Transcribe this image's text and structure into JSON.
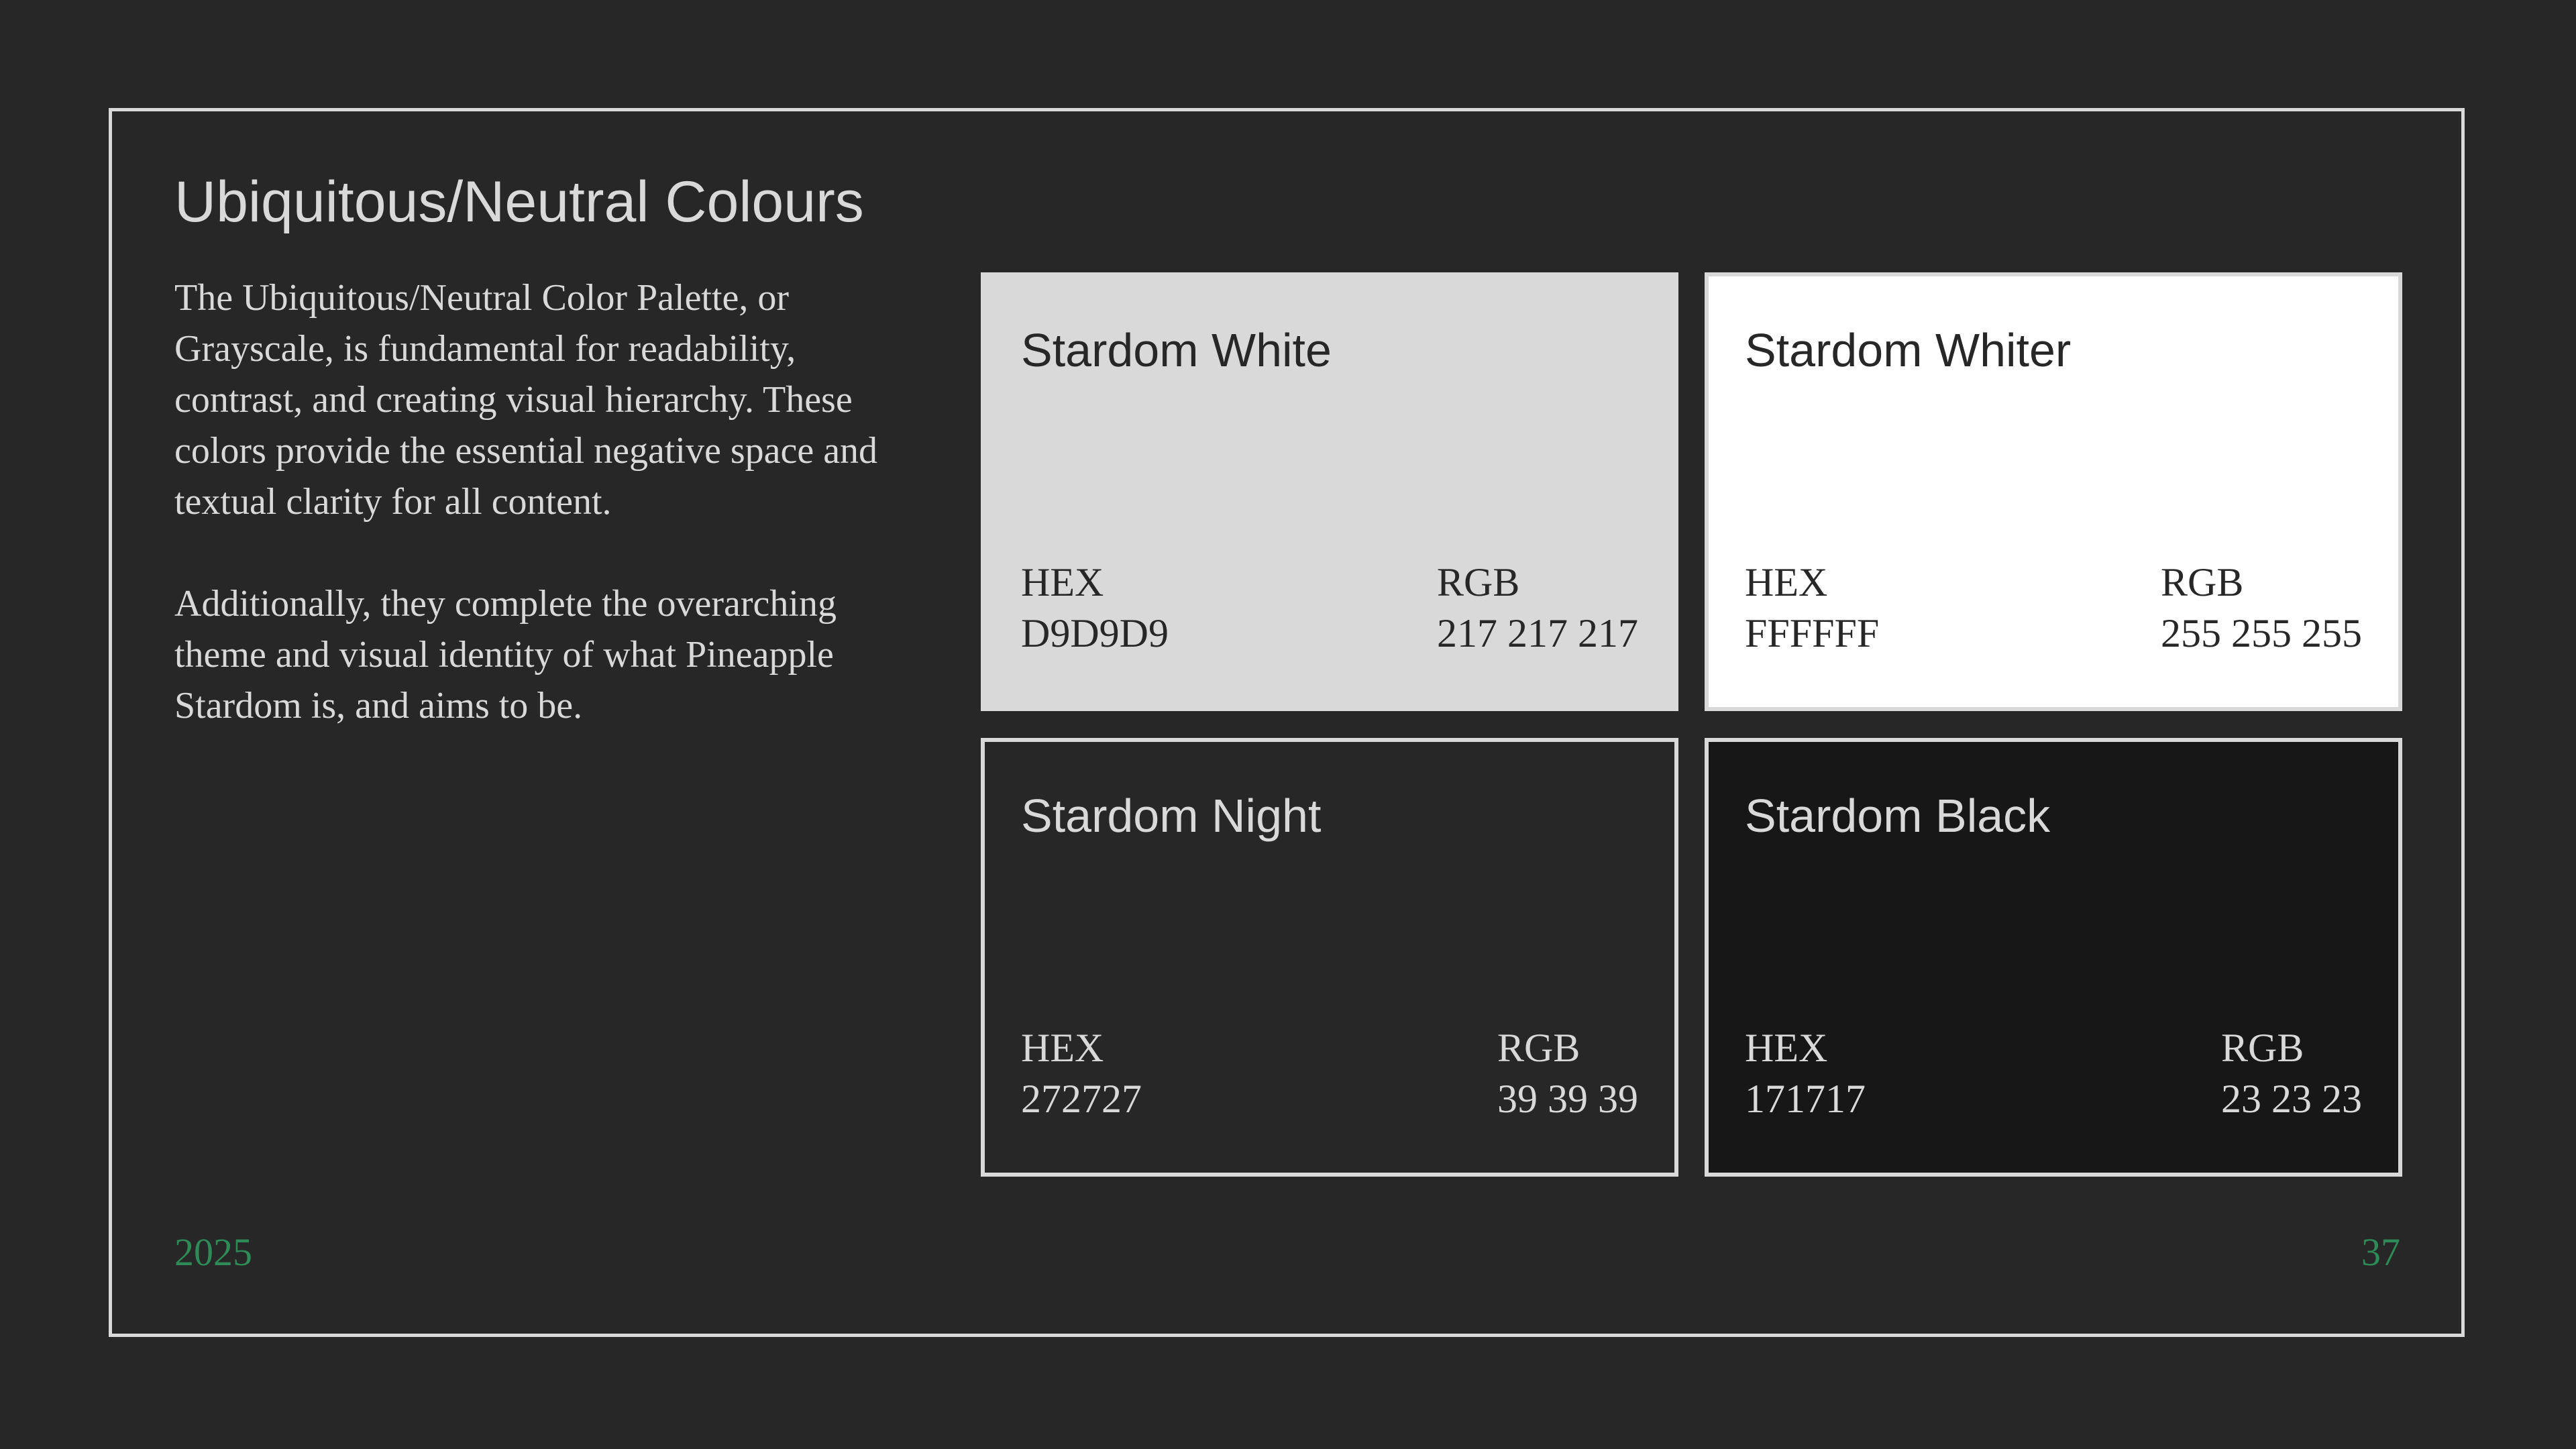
{
  "slide": {
    "title": "Ubiquitous/Neutral Colours",
    "paragraphs": [
      "The Ubiquitous/Neutral Color Palette, or Grayscale, is fundamental for readability, contrast, and creating visual hierarchy. These colors provide the essential negative space and textual clarity for all content.",
      "Additionally, they complete the overarching theme and visual identity of what Pineapple Stardom is, and aims to be."
    ],
    "year": "2025",
    "page_number": "37"
  },
  "swatches": [
    {
      "name": "Stardom White",
      "hex_label": "HEX",
      "hex_value": "D9D9D9",
      "rgb_label": "RGB",
      "rgb_value": "217 217 217",
      "color": "#D9D9D9"
    },
    {
      "name": "Stardom Whiter",
      "hex_label": "HEX",
      "hex_value": "FFFFFF",
      "rgb_label": "RGB",
      "rgb_value": "255 255 255",
      "color": "#FFFFFF"
    },
    {
      "name": "Stardom Night",
      "hex_label": "HEX",
      "hex_value": "272727",
      "rgb_label": "RGB",
      "rgb_value": "39 39 39",
      "color": "#272727"
    },
    {
      "name": "Stardom Black",
      "hex_label": "HEX",
      "hex_value": "171717",
      "rgb_label": "RGB",
      "rgb_value": "23 23 23",
      "color": "#171717"
    }
  ],
  "colors": {
    "background": "#272727",
    "frame": "#D9D9D9",
    "text": "#D9D9D9",
    "accent": "#2E8B57"
  }
}
